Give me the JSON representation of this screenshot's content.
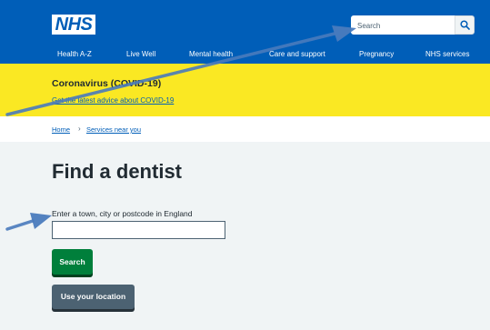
{
  "header": {
    "logo_text": "NHS",
    "search_placeholder": "Search",
    "search_button_icon": "search-icon",
    "nav": [
      "Health A-Z",
      "Live Well",
      "Mental health",
      "Care and support",
      "Pregnancy",
      "NHS services"
    ]
  },
  "banner": {
    "title": "Coronavirus (COVID-19)",
    "link": "Get the latest advice about COVID-19"
  },
  "breadcrumb": {
    "items": [
      "Home",
      "Services near you"
    ],
    "separator": "›"
  },
  "main": {
    "title": "Find a dentist",
    "location_label": "Enter a town, city or postcode in England",
    "location_value": "",
    "search_button": "Search",
    "location_button": "Use your location"
  },
  "annotations": {
    "arrow_color": "#4a7bbd",
    "arrow_icons": [
      "arrow-to-search",
      "arrow-to-input"
    ]
  },
  "colors": {
    "nhs_blue": "#005eb8",
    "banner_yellow": "#fae823",
    "page_bg": "#f0f4f5",
    "button_green": "#007f3b",
    "button_grey": "#4c6272"
  }
}
